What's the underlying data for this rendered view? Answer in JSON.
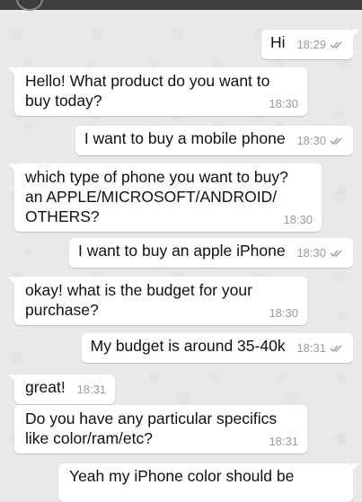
{
  "messages": [
    {
      "text": "Hi",
      "time": "18:29",
      "direction": "out",
      "status_icon": "double-check-icon"
    },
    {
      "text": "Hello! What product do you want to buy today?",
      "time": "18:30",
      "direction": "in"
    },
    {
      "text": "I want to buy a mobile phone",
      "time": "18:30",
      "direction": "out",
      "status_icon": "double-check-icon"
    },
    {
      "text": "which type of phone you want to buy? an APPLE/MICROSOFT/ANDROID/ OTHERS?",
      "time": "18:30",
      "direction": "in"
    },
    {
      "text": "I want to buy an apple iPhone",
      "time": "18:30",
      "direction": "out",
      "status_icon": "double-check-icon"
    },
    {
      "text": "okay! what is the budget for your purchase?",
      "time": "18:30",
      "direction": "in"
    },
    {
      "text": "My budget is around 35-40k",
      "time": "18:31",
      "direction": "out",
      "status_icon": "double-check-icon"
    },
    {
      "text": "great!",
      "time": "18:31",
      "direction": "in"
    },
    {
      "text": "Do you have any particular specifics like color/ram/etc?",
      "time": "18:31",
      "direction": "in"
    },
    {
      "text": "Yeah my iPhone color should be",
      "time": "",
      "direction": "out"
    }
  ],
  "colors": {
    "bubble": "#ffffff",
    "wallpaper": "#e9e9e9",
    "header": "#3d3d3d",
    "meta": "#9a9a9a"
  }
}
